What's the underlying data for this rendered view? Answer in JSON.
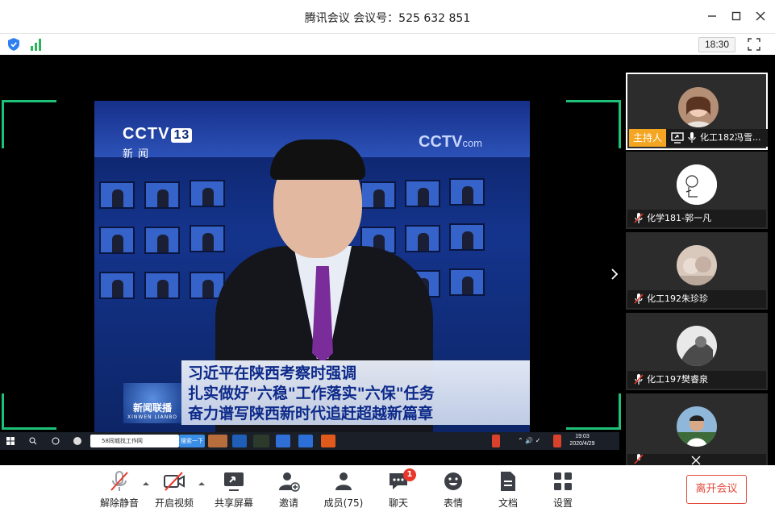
{
  "window": {
    "title": "腾讯会议 会议号：525 632 851",
    "minimize_icon": "minimize-icon",
    "maximize_icon": "maximize-icon",
    "close_icon": "close-icon"
  },
  "status": {
    "time": "18:30",
    "icons": [
      "shield-icon",
      "signal-icon",
      "fullscreen-icon"
    ]
  },
  "shared_screen": {
    "channel_logo": "CCTV",
    "channel_number": "13",
    "channel_sub": "新闻",
    "site_logo": "CCTV",
    "site_suffix": "com",
    "caption_lines": [
      "习近平在陕西考察时强调",
      "扎实做好\"六稳\"工作落实\"六保\"任务",
      "奋力谱写陕西新时代追赶超越新篇章"
    ],
    "program_logo": "新闻联播",
    "program_logo_sub": "XINWEN LIANBO",
    "taskbar": {
      "browser_tab": "58同城找工作网",
      "search_btn": "搜索一下",
      "time": "19:03",
      "date": "2020/4/29"
    }
  },
  "participants": [
    {
      "name": "化工182冯雪...",
      "host_label": "主持人",
      "muted": false,
      "sharing": true
    },
    {
      "name": "化学181-郭一凡",
      "muted": true
    },
    {
      "name": "化工192朱珍珍",
      "muted": true
    },
    {
      "name": "化工197樊睿泉",
      "muted": true
    },
    {
      "name": "",
      "muted": true
    }
  ],
  "toolbar": {
    "unmute": "解除静音",
    "start_video": "开启视频",
    "share_screen": "共享屏幕",
    "invite": "邀请",
    "members": "成员(75)",
    "chat": "聊天",
    "chat_badge": "1",
    "reactions": "表情",
    "docs": "文档",
    "settings": "设置",
    "leave": "离开会议"
  },
  "colors": {
    "accent_green": "#1ec177",
    "host_orange": "#f4a623",
    "leave_red": "#e24a3b",
    "badge_red": "#e8382b"
  }
}
